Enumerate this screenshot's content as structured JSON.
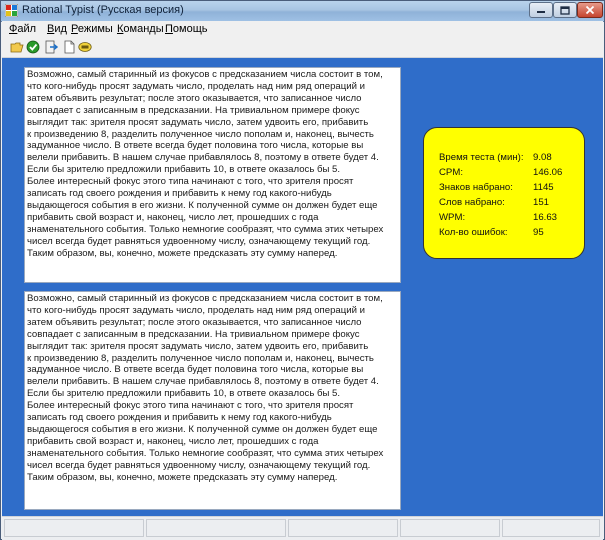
{
  "window": {
    "title": "Rational Typist (Русская версия)"
  },
  "menu": {
    "items": [
      {
        "acc": "Ф",
        "rest": "айл"
      },
      {
        "acc": "В",
        "rest": "ид"
      },
      {
        "acc": "Р",
        "rest": "ежимы"
      },
      {
        "acc": "К",
        "rest": "оманды"
      },
      {
        "acc": "П",
        "rest": "омощь"
      }
    ]
  },
  "toolbar": {
    "icons": [
      "open-folder-icon",
      "checkmark-icon",
      "exit-door-icon",
      "new-document-icon",
      "keyboard-icon"
    ]
  },
  "text": {
    "source": "Возможно, самый старинный из фокусов с предсказанием числа состоит в том,\nчто кого-нибудь просят задумать число, проделать над ним ряд операций и\nзатем объявить результат; после этого оказывается, что записанное число\nсовпадает с записанным в предсказании. На тривиальном примере фокус\nвыглядит так: зрителя просят задумать число, затем удвоить его, прибавить\nк произведению 8, разделить полученное число пополам и, наконец, вычесть\nзадуманное число. В ответе всегда будет половина того числа, которые вы\nвелели прибавить. В нашем случае прибавлялось 8, поэтому в ответе будет 4.\nЕсли бы зрителю предложили прибавить 10, в ответе оказалось бы 5.\n  Более интересный фокус этого типа начинают с того, что зрителя просят\nзаписать год своего рождения и прибавить к нему год какого-нибудь\nвыдающегося события в его жизни. К полученной сумме он должен будет еще\nприбавить свой возраст и, наконец, число лет, прошедших с года\nзнаменательного события. Только немногие сообразят, что сумма этих четырех\nчисел всегда будет равняться удвоенному числу, означающему текущий год.\nТаким образом, вы, конечно, можете предсказать эту сумму наперед.",
    "typed": "Возможно, самый старинный из фокусов с предсказанием числа состоит в том,\nчто кого-нибудь просят задумать число, проделать над ним ряд операций и\nзатем объявить результат; после этого оказывается, что записанное число\nсовпадает с записанным в предсказании. На тривиальном примере фокус\nвыглядит так: зрителя просят задумать число, затем удвоить его, прибавить\nк произведению 8, разделить полученное число пополам и, наконец, вычесть\nзадуманное число. В ответе всегда будет половина того числа, которые вы\nвелели прибавить. В нашем случае прибавлялось 8, поэтому в ответе будет 4.\nЕсли бы зрителю предложили прибавить 10, в ответе оказалось бы 5.\n  Более интересный фокус этого типа начинают с того, что зрителя просят\nзаписать год своего рождения и прибавить к нему год какого-нибудь\nвыдающегося события в его жизни. К полученной сумме он должен будет еще\nприбавить свой возраст и, наконец, число лет, прошедших с года\nзнаменательного события. Только немногие сообразят, что сумма этих четырех\nчисел всегда будет равняться удвоенному числу, означающему текущий год.\nТаким образом, вы, конечно, можете предсказать эту сумму наперед."
  },
  "stats": [
    {
      "label": "Время теста (мин):",
      "value": "9.08"
    },
    {
      "label": "CPM:",
      "value": "146.06"
    },
    {
      "label": "Знаков набрано:",
      "value": "1145"
    },
    {
      "label": "Слов набрано:",
      "value": "151"
    },
    {
      "label": "WPM:",
      "value": "16.63"
    },
    {
      "label": "Кол-во ошибок:",
      "value": "95"
    }
  ],
  "colors": {
    "background": "#2f6dc9",
    "stats_panel": "#ffff00"
  }
}
